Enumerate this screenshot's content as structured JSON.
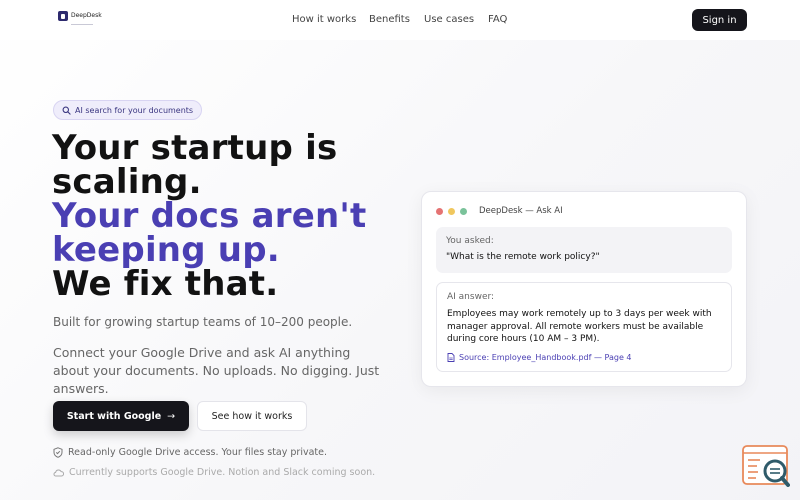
{
  "header": {
    "logo_text": "DeepDesk",
    "nav": [
      "How it works",
      "Benefits",
      "Use cases",
      "FAQ"
    ],
    "signin_label": "Sign in"
  },
  "hero": {
    "badge": "AI search for your documents",
    "title_lines": [
      {
        "text": "Your startup is",
        "tone": "dark"
      },
      {
        "text": "scaling.",
        "tone": "dark"
      },
      {
        "text": "Your docs aren't",
        "tone": "accent"
      },
      {
        "text": "keeping up.",
        "tone": "accent"
      },
      {
        "text": "We fix that.",
        "tone": "dark"
      }
    ],
    "subtitle": "Built for growing startup teams of 10–200 people.",
    "description": "Connect your Google Drive and ask AI anything about your documents. No uploads. No digging. Just answers.",
    "primary_button": "Start with Google",
    "secondary_button": "See how it works",
    "note_privacy": "Read-only Google Drive access. Your files stay private.",
    "note_support": "Currently supports Google Drive. Notion and Slack coming soon."
  },
  "demo": {
    "window_title": "DeepDesk — Ask AI",
    "question_label": "You asked:",
    "question": "\"What is the remote work policy?\"",
    "answer_label": "AI answer:",
    "answer": "Employees may work remotely up to 3 days per week with manager approval. All remote workers must be available during core hours (10 AM – 3 PM).",
    "source": "Source: Employee_Handbook.pdf — Page 4"
  },
  "colors": {
    "accent": "#4a3fb3",
    "dark": "#15151b",
    "dot_red": "#e57373",
    "dot_yellow": "#f0c75e",
    "dot_green": "#7ac29a"
  },
  "icons": {
    "badge_icon": "search-icon",
    "privacy_icon": "shield-icon",
    "support_icon": "cloud-icon",
    "source_icon": "document-icon",
    "help_widget": "search-document-icon"
  }
}
